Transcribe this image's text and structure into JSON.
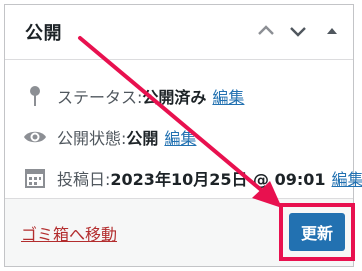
{
  "panel": {
    "title": "公開",
    "header_buttons": [
      "chevron-up-icon",
      "chevron-down-icon",
      "triangle-up-icon"
    ]
  },
  "rows": [
    {
      "icon": "pin-icon",
      "label": "ステータス:",
      "value": "公開済み",
      "link": "編集"
    },
    {
      "icon": "eye-icon",
      "label": "公開状態:",
      "value": "公開",
      "link": "編集"
    },
    {
      "icon": "calendar-icon",
      "label": "投稿日:",
      "value": "2023年10月25日 @ 09:01",
      "link": "編集"
    }
  ],
  "footer": {
    "trash_label": "ゴミ箱へ移動",
    "update_label": "更新"
  },
  "colors": {
    "accent": "#2271b1",
    "trash": "#b32d2e",
    "annotation": "#e8114f",
    "border": "#c3c4c7"
  }
}
